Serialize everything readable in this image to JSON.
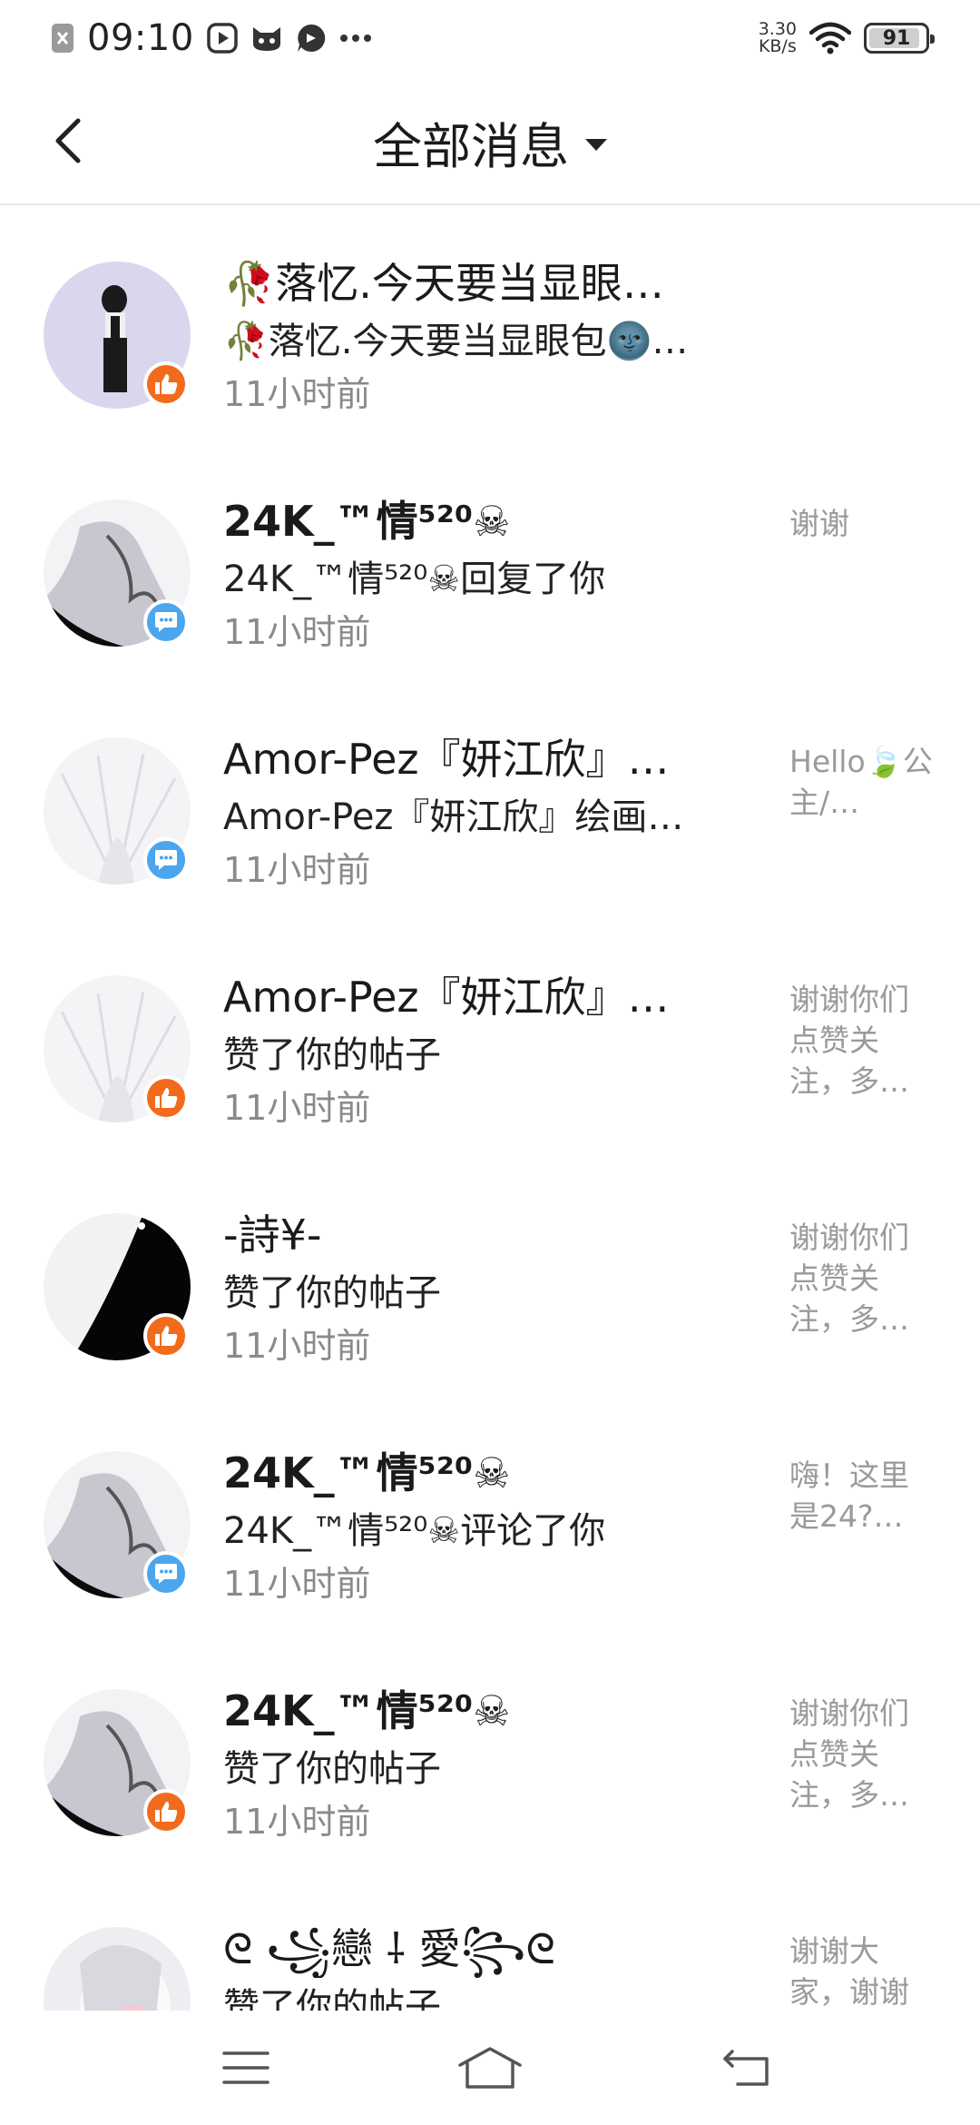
{
  "status_bar": {
    "time": "09:10",
    "net_speed_value": "3.30",
    "net_speed_unit": "KB/s",
    "battery": "91",
    "battery_level": 0.91,
    "icons": [
      "close-notification-icon",
      "video-app-icon",
      "cat-app-icon",
      "chat-app-icon",
      "more-dots-icon",
      "wifi-icon",
      "battery-icon"
    ]
  },
  "header": {
    "title": "全部消息",
    "back_icon": "chevron-left-icon",
    "dropdown_icon": "caret-down-icon"
  },
  "messages": [
    {
      "name": "🥀落忆.今天要当显眼…",
      "desc": "🥀落忆.今天要当显眼包🌚…",
      "time": "11小时前",
      "preview": "",
      "badge": "like",
      "bold": false
    },
    {
      "name": "24K_™情⁵²⁰☠",
      "desc": "24K_™情⁵²⁰☠回复了你",
      "time": "11小时前",
      "preview": "谢谢",
      "badge": "comment",
      "bold": true
    },
    {
      "name": "Amor-Pez『妍江欣』…",
      "desc": "Amor-Pez『妍江欣』绘画…",
      "time": "11小时前",
      "preview": "Hello🍃公主/…",
      "badge": "comment",
      "bold": false
    },
    {
      "name": "Amor-Pez『妍江欣』…",
      "desc": "赞了你的帖子",
      "time": "11小时前",
      "preview": "谢谢你们点赞关注，多…",
      "badge": "like",
      "bold": false
    },
    {
      "name": "-詩¥-",
      "desc": "赞了你的帖子",
      "time": "11小时前",
      "preview": "谢谢你们点赞关注，多…",
      "badge": "like",
      "bold": false
    },
    {
      "name": "24K_™情⁵²⁰☠",
      "desc": "24K_™情⁵²⁰☠评论了你",
      "time": "11小时前",
      "preview": "嗨！这里是24?…",
      "badge": "comment",
      "bold": true
    },
    {
      "name": "24K_™情⁵²⁰☠",
      "desc": "赞了你的帖子",
      "time": "11小时前",
      "preview": "谢谢你们点赞关注，多…",
      "badge": "like",
      "bold": true
    },
    {
      "name": "ᘓ ꧁戀 ⸸ 愛꧂ᘓ",
      "desc": "赞了你的帖子",
      "time": "",
      "preview": "谢谢大家，谢谢",
      "badge": "none",
      "bold": false
    }
  ],
  "nav_bar": {
    "icons": [
      "menu-icon",
      "home-icon",
      "back-icon"
    ]
  },
  "colors": {
    "like_badge": "#f26b1d",
    "comment_badge": "#4ba6ee",
    "time_text": "#8a8a8a",
    "preview_text": "#9a9a9a",
    "divider": "#e6e6e6"
  }
}
